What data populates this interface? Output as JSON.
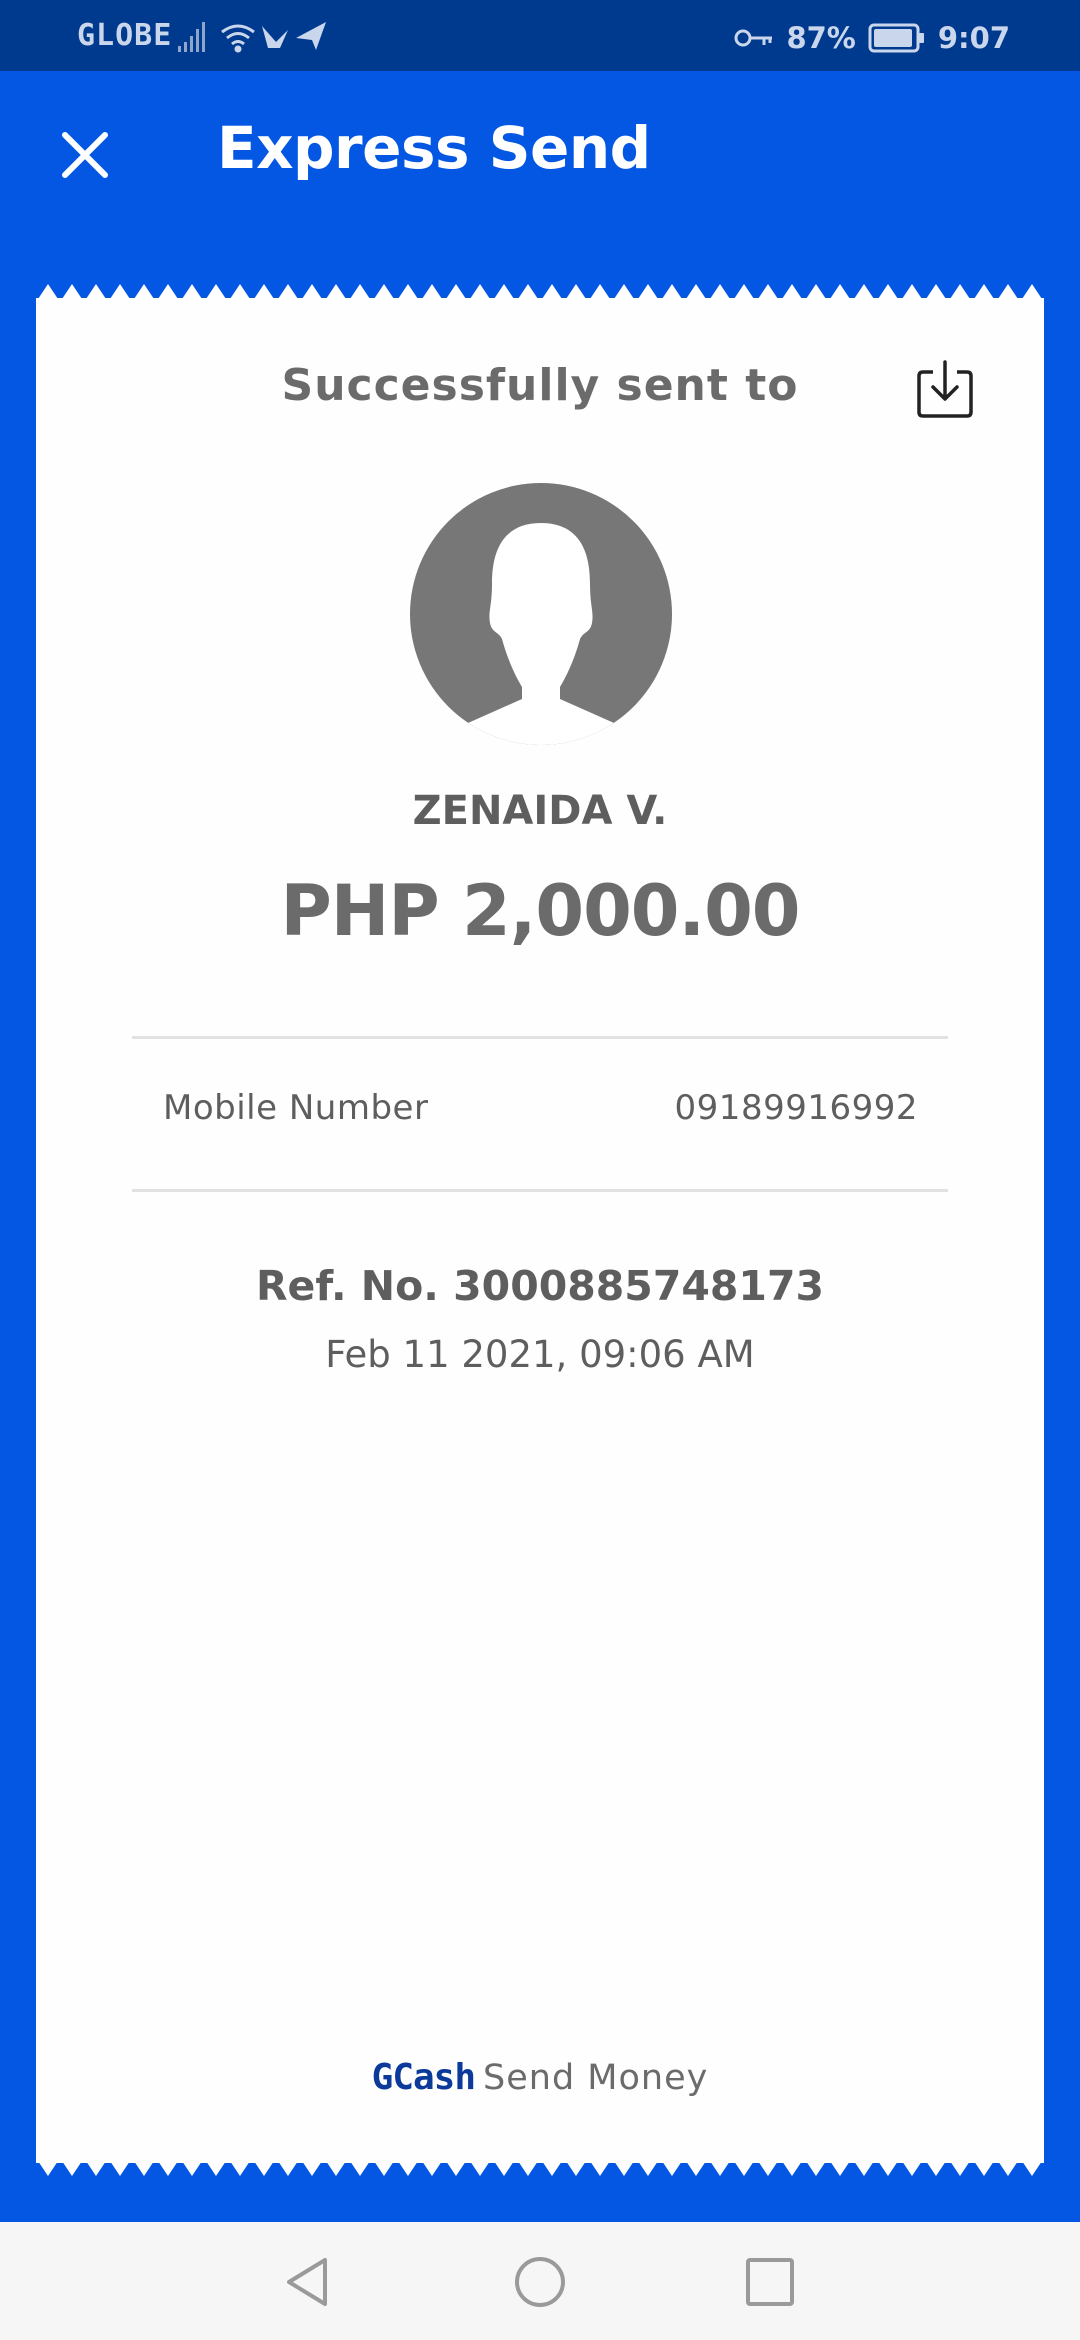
{
  "status_bar": {
    "carrier": "GLOBE",
    "battery": "87%",
    "time": "9:07",
    "icons": [
      "signal-icon",
      "wifi-icon",
      "bird-icon",
      "send-arrow-icon",
      "key-icon",
      "battery-icon"
    ]
  },
  "header": {
    "title": "Express Send",
    "close_icon": "close-icon"
  },
  "receipt": {
    "success_text": "Successfully sent to",
    "download_icon": "download-icon",
    "avatar_icon": "avatar-placeholder-icon",
    "recipient_name": "ZENAIDA V.",
    "amount": "PHP 2,000.00",
    "details": [
      {
        "label": "Mobile Number",
        "value": "09189916992"
      }
    ],
    "ref_no": "Ref. No. 3000885748173",
    "date_time": "Feb 11 2021, 09:06 AM",
    "footer_brand": "GCash",
    "footer_text": "Send Money"
  },
  "nav_bar": {
    "buttons": [
      "back-icon",
      "home-icon",
      "recents-icon"
    ]
  },
  "colors": {
    "primary_blue": "#0457e3",
    "status_bar": "#003a8e",
    "text_gray": "#5e5e5e",
    "brand_blue": "#0b3a9a"
  }
}
